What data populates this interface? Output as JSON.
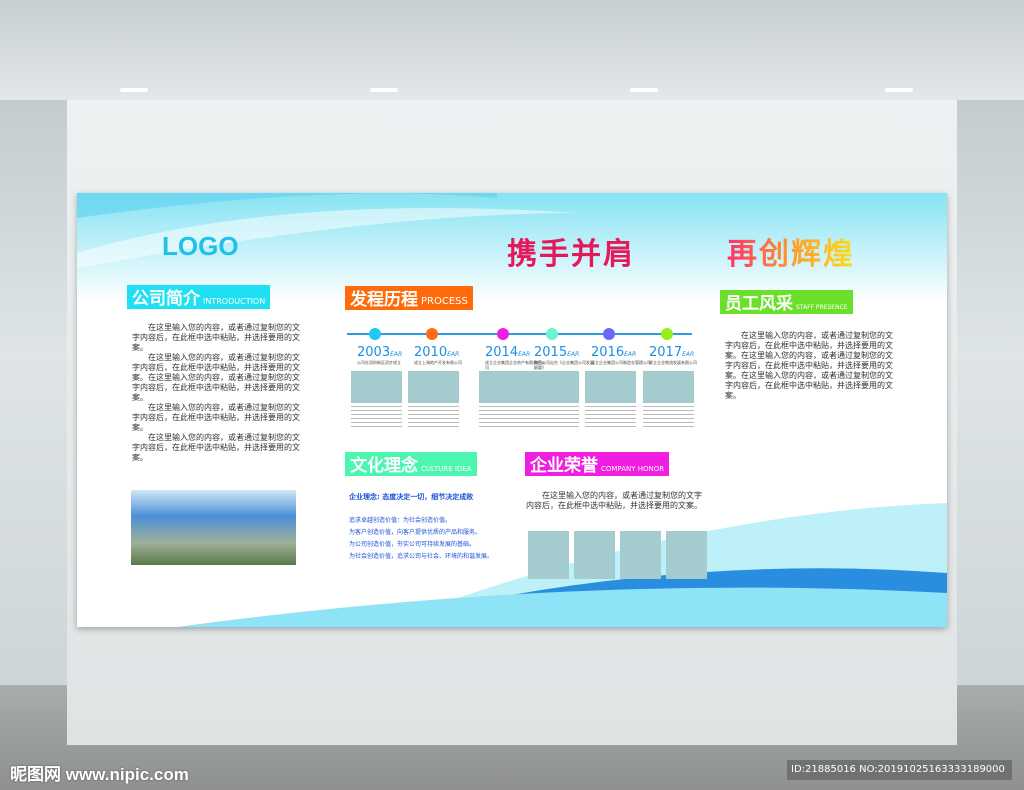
{
  "header": {
    "logo": "LOGO",
    "slogan_left": "携手并肩",
    "slogan_right": "再创辉煌"
  },
  "intro": {
    "title": "公司简介",
    "subtitle": "INTRODUCTION",
    "paragraphs": [
      "在这里输入您的内容，或者通过复制您的文字内容后，在此框中选中粘贴，并选择要用的文案。",
      "在这里输入您的内容，或者通过复制您的文字内容后，在此框中选中粘贴，并选择要用的文案。在这里输入您的内容，或者通过复制您的文字内容后，在此框中选中粘贴，并选择要用的文案。",
      "在这里输入您的内容，或者通过复制您的文字内容后，在此框中选中粘贴，并选择要用的文案。",
      "在这里输入您的内容，或者通过复制您的文字内容后，在此框中选中粘贴，并选择要用的文案。"
    ]
  },
  "process": {
    "title": "发程历程",
    "subtitle": "PROCESS",
    "year_suffix": "EAR",
    "milestones": [
      {
        "year": "2003",
        "caption": "公司在深圳新区初步成立",
        "color": "#1fc8f5"
      },
      {
        "year": "2010",
        "caption": "成立上海地产开发有限公司",
        "color": "#ff6a13"
      },
      {
        "year": "2014",
        "caption": "成立企业集团企业房产有限责任公司",
        "color": "#f01ee0"
      },
      {
        "year": "2015",
        "caption": "集团公司出台《企业集团公司发展纲要》",
        "color": "#6af5cf"
      },
      {
        "year": "2016",
        "caption": "成立企业集团公司制造业管理公司",
        "color": "#6a6af5"
      },
      {
        "year": "2017",
        "caption": "成立企业物流发展有限公司",
        "color": "#94f018"
      }
    ]
  },
  "staff": {
    "title": "员工风采",
    "subtitle": "STAFF PRESENCE",
    "text": "在这里输入您的内容，或者通过复制您的文字内容后，在此框中选中粘贴，并选择要用的文案。在这里输入您的内容，或者通过复制您的文字内容后，在此框中选中粘贴，并选择要用的文案。在这里输入您的内容，或者通过复制您的文字内容后，在此框中选中粘贴，并选择要用的文案。"
  },
  "culture": {
    "title": "文化理念",
    "subtitle": "CULTURE  IDEA",
    "motto": "企业理念:   态度决定一切，细节决定成败",
    "values": [
      "追求卓越创造价值：为社会创造价值。",
      "为客户创造价值，向客户提供优质的产品和服务。",
      "为公司创造价值，夯实公司可持续发展的基础。",
      "为社会创造价值，追求公司与社会、环境的和谐发展。"
    ]
  },
  "honor": {
    "title": "企业荣誉",
    "subtitle": "COMPANY  HONOR",
    "text": "在这里输入您的内容，或者通过复制您的文字内容后，在此框中选中粘贴，并选择要用的文案。"
  },
  "watermark": {
    "site": "昵图网 www.nipic.com",
    "id": "ID:21885016 NO:20191025163333189000"
  },
  "colors": {
    "intro": "#1fe0f2",
    "process": "#ff6a0a",
    "staff": "#6ae02a",
    "culture": "#4cf5b0",
    "honor": "#f01ee0"
  }
}
